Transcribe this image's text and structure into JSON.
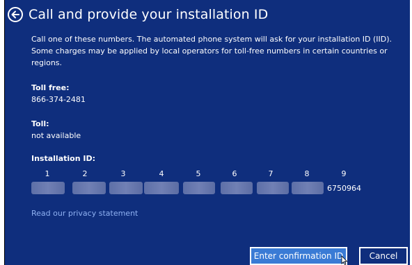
{
  "header": {
    "title": "Call and provide your installation ID"
  },
  "description": "Call one of these numbers. The automated phone system will ask for your installation ID (IID). Some charges may be applied by local operators for toll-free numbers in certain countries or regions.",
  "toll_free": {
    "label": "Toll free:",
    "value": "866-374-2481"
  },
  "toll": {
    "label": "Toll:",
    "value": "not available"
  },
  "installation_id": {
    "label": "Installation ID:",
    "groups": [
      "1",
      "2",
      "3",
      "4",
      "5",
      "6",
      "7",
      "8",
      "9"
    ],
    "last_group_value": "6750964"
  },
  "privacy_link": "Read our privacy statement",
  "buttons": {
    "confirm": "Enter confirmation ID",
    "cancel": "Cancel"
  },
  "colors": {
    "background": "#0f2e7d",
    "accent": "#3a7bd5",
    "link": "#8fb1f2"
  }
}
